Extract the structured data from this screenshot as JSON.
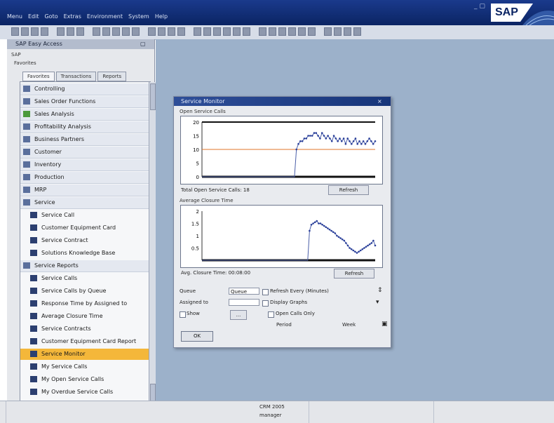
{
  "titlebar": {
    "menu_items": [
      "Menu",
      "Edit",
      "Goto",
      "Extras",
      "Environment",
      "System",
      "Help"
    ],
    "logo_text": "SAP",
    "bg_color": "#0e2a6e"
  },
  "nav": {
    "header_title": "SAP Easy Access",
    "header_close": "▢",
    "path1": "SAP",
    "path2": "Favorites",
    "tabs": [
      "Favorites",
      "Transactions",
      "Reports"
    ],
    "items": [
      {
        "label": "Controlling",
        "icon": "folder-icon",
        "type": "folder"
      },
      {
        "label": "Sales Order Functions",
        "icon": "folder-icon",
        "type": "folder"
      },
      {
        "label": "Sales Analysis",
        "icon": "leaf-icon",
        "type": "folder"
      },
      {
        "label": "Profitability Analysis",
        "icon": "folder-icon",
        "type": "folder"
      },
      {
        "label": "Business Partners",
        "icon": "folder-icon",
        "type": "folder"
      },
      {
        "label": "Customer",
        "icon": "folder-icon",
        "type": "folder"
      },
      {
        "label": "Inventory",
        "icon": "folder-icon",
        "type": "folder"
      },
      {
        "label": "Production",
        "icon": "folder-icon",
        "type": "folder"
      },
      {
        "label": "MRP",
        "icon": "folder-icon",
        "type": "folder"
      },
      {
        "label": "Service",
        "icon": "folder-open-icon",
        "type": "folder"
      },
      {
        "label": "Service Call",
        "icon": "doc-icon",
        "type": "leaf"
      },
      {
        "label": "Customer Equipment Card",
        "icon": "doc-icon",
        "type": "leaf"
      },
      {
        "label": "Service Contract",
        "icon": "doc-icon",
        "type": "leaf"
      },
      {
        "label": "Solutions Knowledge Base",
        "icon": "doc-icon",
        "type": "leaf"
      },
      {
        "label": "Service Reports",
        "icon": "folder-open-icon",
        "type": "folder"
      },
      {
        "label": "Service Calls",
        "icon": "doc-icon",
        "type": "leaf"
      },
      {
        "label": "Service Calls by Queue",
        "icon": "doc-icon",
        "type": "leaf"
      },
      {
        "label": "Response Time by Assigned to",
        "icon": "doc-icon",
        "type": "leaf"
      },
      {
        "label": "Average Closure Time",
        "icon": "doc-icon",
        "type": "leaf"
      },
      {
        "label": "Service Contracts",
        "icon": "doc-icon",
        "type": "leaf"
      },
      {
        "label": "Customer Equipment Card Report",
        "icon": "doc-icon",
        "type": "leaf"
      },
      {
        "label": "Service Monitor",
        "icon": "doc-icon",
        "type": "leaf",
        "selected": true
      },
      {
        "label": "My Service Calls",
        "icon": "doc-icon",
        "type": "leaf"
      },
      {
        "label": "My Open Service Calls",
        "icon": "doc-icon",
        "type": "leaf"
      },
      {
        "label": "My Overdue Service Calls",
        "icon": "doc-icon",
        "type": "leaf"
      }
    ]
  },
  "dialog": {
    "title": "Service Monitor",
    "close": "×",
    "chart1": {
      "section_label": "Open Service Calls",
      "caption": "Total Open Service Calls: 18",
      "button": "Refresh",
      "y_ticks": [
        "20",
        "15",
        "10",
        "5",
        "0"
      ]
    },
    "chart2": {
      "section_label": "Average Closure Time",
      "caption": "Avg. Closure Time: 00:08:00",
      "button": "Refresh",
      "y_ticks": [
        "2",
        "1.5",
        "1",
        "0.5"
      ]
    },
    "fields": {
      "queue_label": "Queue",
      "queue_value": "Queue",
      "assigned_label": "Assigned to",
      "assigned_value": "",
      "show_label": "Show",
      "show_btn": "...",
      "right1_label": "Refresh Every (Minutes)",
      "right2_label": "Display Graphs",
      "right3_label": "Open Calls Only",
      "right4_label": "Period",
      "right4_value": "Week"
    },
    "ok_label": "OK"
  },
  "statusbar": {
    "line1": "CRM 2005",
    "line2": "manager"
  },
  "chart_data": [
    {
      "type": "line",
      "title": "Open Service Calls",
      "xlabel": "",
      "ylabel": "",
      "ylim": [
        0,
        20
      ],
      "grid": false,
      "threshold": 10,
      "series": [
        {
          "values": [
            0,
            0,
            0,
            0,
            0,
            0,
            0,
            0,
            0,
            0,
            0,
            0,
            0,
            0,
            0,
            0,
            0,
            0,
            0,
            0,
            0,
            0,
            0,
            0,
            0,
            0,
            0,
            0,
            0,
            0,
            0,
            0,
            0,
            0,
            0,
            0,
            0,
            0,
            0,
            0,
            0,
            0,
            0,
            0,
            0,
            0,
            0,
            0,
            10,
            12,
            13,
            13,
            14,
            14,
            15,
            15,
            15,
            16,
            16,
            15,
            14,
            16,
            15,
            14,
            15,
            14,
            13,
            15,
            14,
            13,
            14,
            13,
            14,
            12,
            14,
            13,
            12,
            13,
            14,
            12,
            13,
            12,
            13,
            12,
            13,
            14,
            13,
            12,
            13
          ]
        }
      ]
    },
    {
      "type": "line",
      "title": "Average Closure Time",
      "xlabel": "",
      "ylabel": "",
      "ylim": [
        0,
        2
      ],
      "grid": false,
      "series": [
        {
          "values": [
            0,
            0,
            0,
            0,
            0,
            0,
            0,
            0,
            0,
            0,
            0,
            0,
            0,
            0,
            0,
            0,
            0,
            0,
            0,
            0,
            0,
            0,
            0,
            0,
            0,
            0,
            0,
            0,
            0,
            0,
            0,
            0,
            0,
            0,
            0,
            0,
            0,
            0,
            0,
            0,
            0,
            0,
            0,
            0,
            0,
            0,
            0,
            0,
            0,
            0,
            0,
            0,
            0,
            0,
            0,
            0,
            0,
            0,
            0,
            1.2,
            1.45,
            1.5,
            1.55,
            1.6,
            1.5,
            1.5,
            1.45,
            1.4,
            1.35,
            1.3,
            1.25,
            1.2,
            1.15,
            1.1,
            1.0,
            0.95,
            0.9,
            0.85,
            0.8,
            0.7,
            0.6,
            0.5,
            0.45,
            0.4,
            0.35,
            0.3,
            0.35,
            0.4,
            0.45,
            0.5,
            0.55,
            0.6,
            0.65,
            0.7,
            0.8,
            0.6
          ]
        }
      ]
    }
  ]
}
